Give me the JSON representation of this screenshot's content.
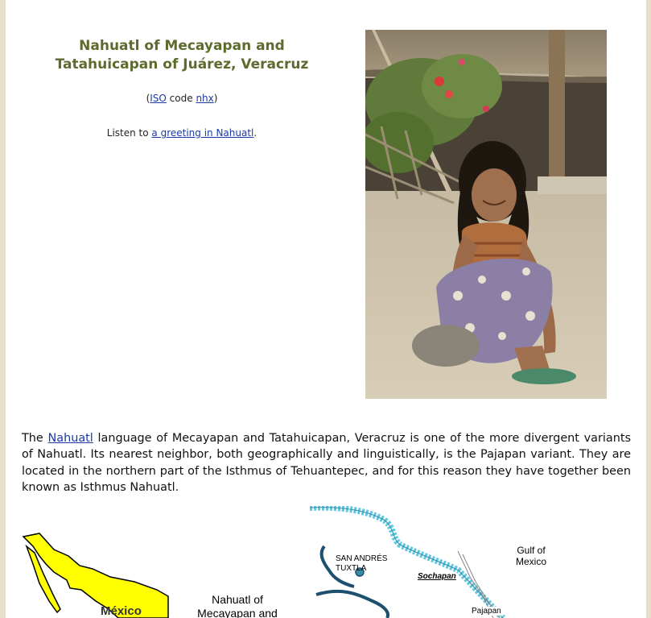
{
  "title": {
    "line1": "Nahuatl of Mecayapan and",
    "line2": "Tatahuicapan of Juárez, Veracruz"
  },
  "iso": {
    "open": "(",
    "iso_link": "ISO",
    "middle": " code ",
    "code_link": "nhx",
    "close": ")"
  },
  "listen": {
    "prefix": "Listen to ",
    "link": "a greeting in Nahuatl",
    "suffix": "."
  },
  "paragraph": {
    "before": "The ",
    "link": "Nahuatl",
    "after": " language of Mecayapan and Tatahuicapan, Veracruz is one of the more divergent variants of Nahuatl. Its nearest neighbor, both geographically and linguistically, is the Pajapan variant. They are located in the northern part of the Isthmus of Tehuantepec, and for this reason they have together been known as Isthmus Nahuatl."
  },
  "map_left": {
    "country_label": "México"
  },
  "map_caption": {
    "line1": "Nahuatl of",
    "line2": "Mecayapan and"
  },
  "map_right": {
    "city_line1": "SAN ANDRÉS",
    "city_line2": "TUXTLA",
    "sochapan": "Sochapan",
    "gulf_line1": "Gulf of",
    "gulf_line2": "Mexico",
    "pajapan": "Pajapan"
  },
  "colors": {
    "title": "#5d6b2e",
    "link": "#1a3aa8",
    "background": "#e8dfcb",
    "map_country": "#ffff00",
    "water": "#5ec8e0"
  }
}
